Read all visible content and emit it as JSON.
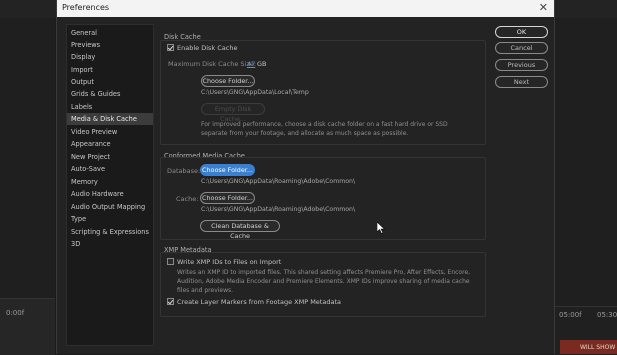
{
  "window": {
    "title": "Preferences",
    "close_glyph": "✕"
  },
  "sidebar": {
    "items": [
      {
        "label": "General"
      },
      {
        "label": "Previews"
      },
      {
        "label": "Display"
      },
      {
        "label": "Import"
      },
      {
        "label": "Output"
      },
      {
        "label": "Grids & Guides"
      },
      {
        "label": "Labels"
      },
      {
        "label": "Media & Disk Cache",
        "selected": true
      },
      {
        "label": "Video Preview"
      },
      {
        "label": "Appearance"
      },
      {
        "label": "New Project"
      },
      {
        "label": "Auto-Save"
      },
      {
        "label": "Memory"
      },
      {
        "label": "Audio Hardware"
      },
      {
        "label": "Audio Output Mapping"
      },
      {
        "label": "Type"
      },
      {
        "label": "Scripting & Expressions"
      },
      {
        "label": "3D"
      }
    ]
  },
  "disk_cache": {
    "section_label": "Disk Cache",
    "enable_label": "Enable Disk Cache",
    "enable_checked": true,
    "max_size_label": "Maximum Disk Cache Size:",
    "max_size_value": "47",
    "max_size_unit": "GB",
    "choose_folder_label": "Choose Folder...",
    "folder_path": "C:\\Users\\GNG\\AppData\\Local\\Temp",
    "empty_label": "Empty Disk Cache...",
    "description": "For improved performance, choose a disk cache folder on a fast hard drive or SSD separate from your footage, and allocate as much space as possible."
  },
  "conformed_cache": {
    "section_label": "Conformed Media Cache",
    "database_label": "Database:",
    "database_button": "Choose Folder...",
    "database_path": "C:\\Users\\GNG\\AppData\\Roaming\\Adobe\\Common\\",
    "cache_label": "Cache:",
    "cache_button": "Choose Folder...",
    "cache_path": "C:\\Users\\GNG\\AppData\\Roaming\\Adobe\\Common\\",
    "clean_button": "Clean Database & Cache"
  },
  "xmp": {
    "section_label": "XMP Metadata",
    "write_label": "Write XMP IDs to Files on Import",
    "write_checked": false,
    "write_description": "Writes an XMP ID to imported files. This shared setting affects Premiere Pro, After Effects, Encore, Audition, Adobe Media Encoder and Premiere Elements. XMP IDs improve sharing of media cache files and previews.",
    "markers_label": "Create Layer Markers from Footage XMP Metadata",
    "markers_checked": true
  },
  "actions": {
    "ok": "OK",
    "cancel": "Cancel",
    "previous": "Previous",
    "next": "Next"
  },
  "background": {
    "time_left": "0:00f",
    "time_right": "05:00f",
    "time_right2": "05:30",
    "red_label": "WILL SHOW",
    "accent": "#3a7fd0"
  }
}
